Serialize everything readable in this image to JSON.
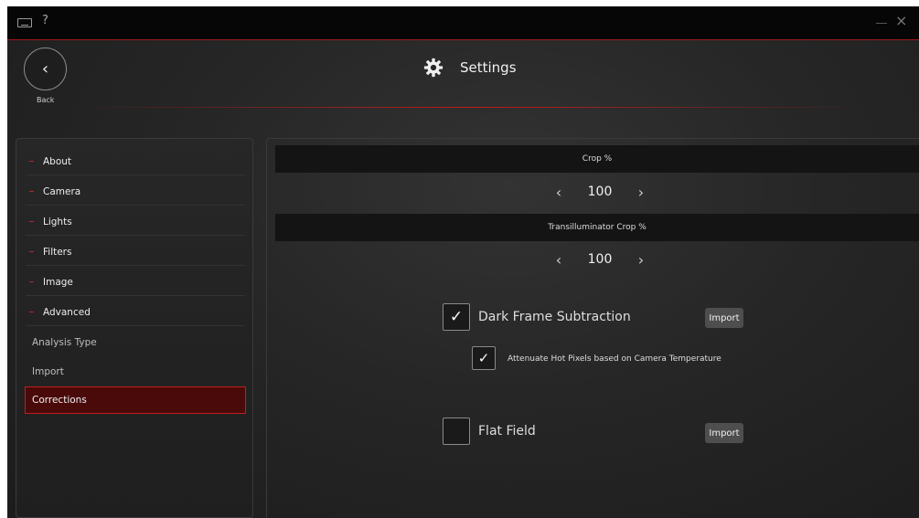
{
  "titlebar": {
    "help_label": "?",
    "close_label": "×",
    "keyboard_icon": "keyboard-icon"
  },
  "header": {
    "back_glyph": "‹",
    "back_label": "Back",
    "title": "Settings",
    "title_icon": "gear-icon"
  },
  "sidebar": {
    "items": [
      {
        "label": "About"
      },
      {
        "label": "Camera"
      },
      {
        "label": "Lights"
      },
      {
        "label": "Filters"
      },
      {
        "label": "Image"
      },
      {
        "label": "Advanced"
      }
    ],
    "subitems": [
      {
        "label": "Analysis Type",
        "active": false
      },
      {
        "label": "Import",
        "active": false
      },
      {
        "label": "Corrections",
        "active": true
      }
    ]
  },
  "main": {
    "crop": {
      "header": "Crop %",
      "value": "100",
      "prev": "‹",
      "next": "›"
    },
    "trans_crop": {
      "header": "Transilluminator Crop %",
      "value": "100",
      "prev": "‹",
      "next": "›"
    },
    "dark_frame": {
      "label": "Dark Frame Subtraction",
      "checked": true,
      "check_glyph": "✓",
      "import_label": "Import"
    },
    "attenuate": {
      "label": "Attenuate Hot Pixels based on Camera Temperature",
      "checked": true,
      "check_glyph": "✓"
    },
    "flat_field": {
      "label": "Flat Field",
      "checked": false,
      "check_glyph": "",
      "import_label": "Import"
    }
  },
  "colors": {
    "accent": "#c21d1d",
    "background": "#262626",
    "active_item": "#4a0a0a"
  }
}
